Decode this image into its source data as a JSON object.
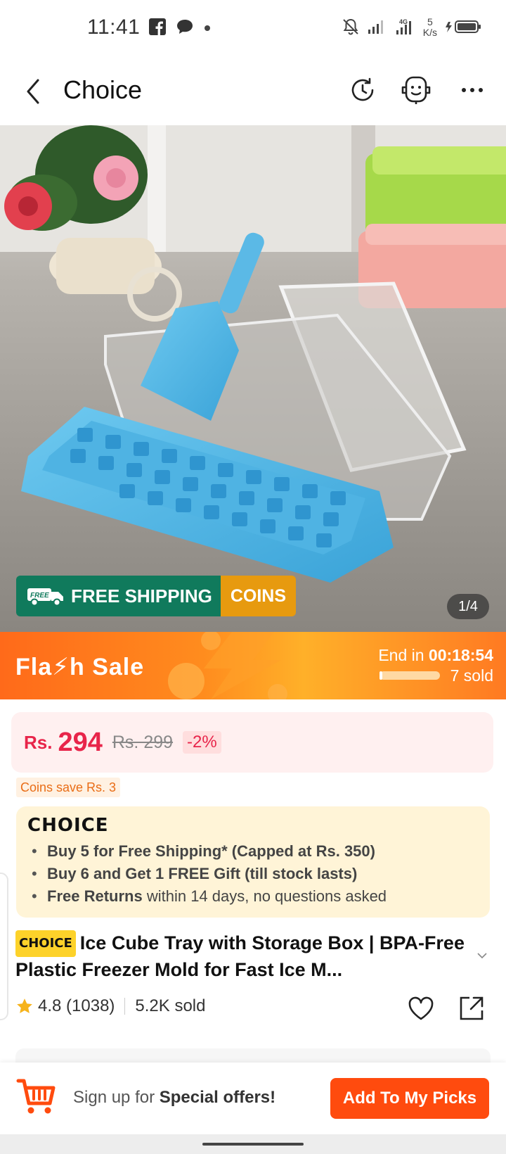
{
  "status_bar": {
    "time": "11:41",
    "speed_value": "5",
    "speed_unit": "K/s",
    "network": "4G"
  },
  "header": {
    "title": "Choice",
    "icons": [
      "back-arrow-icon",
      "history-refresh-icon",
      "customer-service-icon",
      "more-icon"
    ]
  },
  "gallery": {
    "page_indicator": "1/4",
    "free_shipping_label": "FREE SHIPPING",
    "free_tag": "FREE",
    "coins_label": "COINS"
  },
  "flash_sale": {
    "title": "Fla⚡h  Sale",
    "end_prefix": "End in ",
    "countdown": "00:18:54",
    "sold": "7 sold",
    "progress": 0.05
  },
  "price": {
    "currency": "Rs.",
    "current": "294",
    "original": "Rs. 299",
    "discount": "-2%"
  },
  "coins_save": "Coins save Rs. 3",
  "choice_box": {
    "logo": "CHOICE",
    "lines": [
      {
        "text": "Buy 5 for  Free Shipping* (Capped at Rs. 350)"
      },
      {
        "text": "Buy 6 and Get 1 FREE Gift (till stock lasts)"
      },
      {
        "bold": "Free Returns",
        "text": " within 14 days, no questions asked"
      }
    ]
  },
  "product": {
    "tag": "CHOICE",
    "title": "Ice Cube Tray with Storage Box | BPA-Free Plastic Freezer Mold for Fast Ice M...",
    "rating": "4.8 (1038)",
    "sold": "5.2K sold"
  },
  "bottom_bar": {
    "signup_prefix": "Sign up for ",
    "signup_bold": "Special offers!",
    "add_button": "Add To My Picks"
  },
  "colors": {
    "accent": "#ff4b0e",
    "price_red": "#e8254a",
    "shipping_green": "#107a5c",
    "coins_orange": "#e79a0f",
    "choice_bg": "#fff4d7"
  }
}
